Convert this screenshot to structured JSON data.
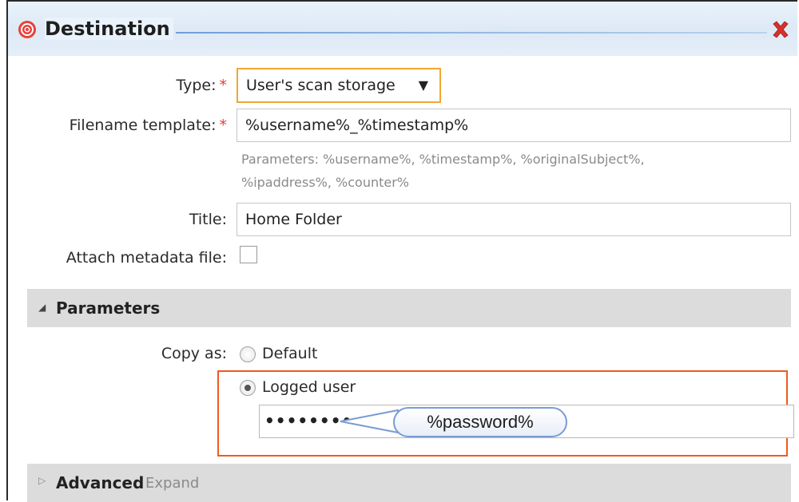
{
  "dialog": {
    "title": "Destination",
    "close_icon": "close-icon",
    "title_icon": "target-icon"
  },
  "form": {
    "type_label": "Type:",
    "type_value": "User's scan storage",
    "filename_label": "Filename template:",
    "filename_value": "%username%_%timestamp%",
    "hint_line1": "Parameters: %username%, %timestamp%, %originalSubject%,",
    "hint_line2": "%ipaddress%, %counter%",
    "title_label": "Title:",
    "title_value": "Home Folder",
    "attach_label": "Attach metadata file:",
    "required_mark": "*"
  },
  "parameters": {
    "section_title": "Parameters",
    "copy_as_label": "Copy as:",
    "option_default": "Default",
    "option_logged": "Logged user",
    "password_masked": "••••••••••",
    "callout_text": "%password%"
  },
  "advanced": {
    "section_title": "Advanced",
    "expand_label": "Expand"
  },
  "colors": {
    "accent_orange": "#f05a1e",
    "select_border": "#f0a830",
    "required": "#e0403a",
    "close_red": "#d9302a"
  }
}
